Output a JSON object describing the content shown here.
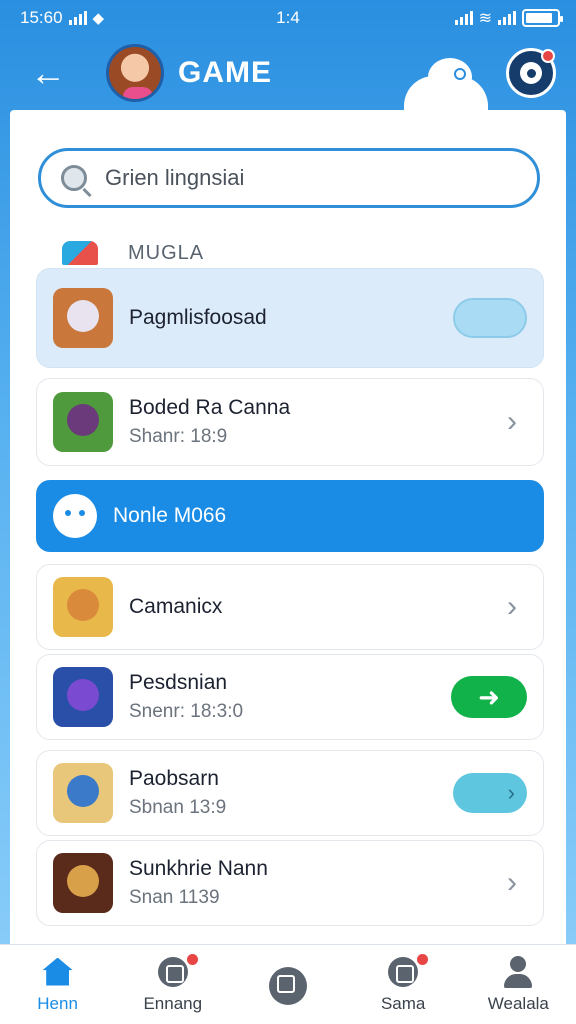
{
  "status": {
    "time_left": "15:60",
    "time_center": "1:4"
  },
  "header": {
    "title": "GAME"
  },
  "search": {
    "text": "Grien lingnsiai"
  },
  "section": {
    "label": "MUGLA"
  },
  "rows": [
    {
      "title": "Pagmlisfoosad",
      "subtitle": "",
      "action": "toggle",
      "icon_color": "#c9773a"
    },
    {
      "title": "Boded Ra Canna",
      "subtitle": "Shanr: 18:9",
      "action": "chevron",
      "icon_color": "#4f9a3c"
    },
    {
      "title": "Nonle M066",
      "subtitle": "",
      "action": "none",
      "icon_color": "#ffffff"
    },
    {
      "title": "Camanicx",
      "subtitle": "",
      "action": "chevron",
      "icon_color": "#e9b84a"
    },
    {
      "title": "Pesdsnian",
      "subtitle": "Snenr: 18:3:0",
      "action": "green-button",
      "icon_color": "#2a4fa8"
    },
    {
      "title": "Paobsarn",
      "subtitle": "Sbnan 13:9",
      "action": "teal-toggle",
      "icon_color": "#e9c77a"
    },
    {
      "title": "Sunkhrie Nann",
      "subtitle": "Snan 1139",
      "action": "chevron",
      "icon_color": "#5a2a1a"
    }
  ],
  "bottom_nav": [
    {
      "label": "Henn",
      "icon": "home-icon",
      "active": true
    },
    {
      "label": "Ennang",
      "icon": "game-badge-icon",
      "active": false
    },
    {
      "label": "",
      "icon": "center-square-icon",
      "active": false
    },
    {
      "label": "Sama",
      "icon": "record-icon",
      "active": false
    },
    {
      "label": "Wealala",
      "icon": "person-icon",
      "active": false
    }
  ],
  "colors": {
    "accent": "#1a8ce6",
    "green": "#12b24a",
    "highlight": "#dcebf9"
  }
}
